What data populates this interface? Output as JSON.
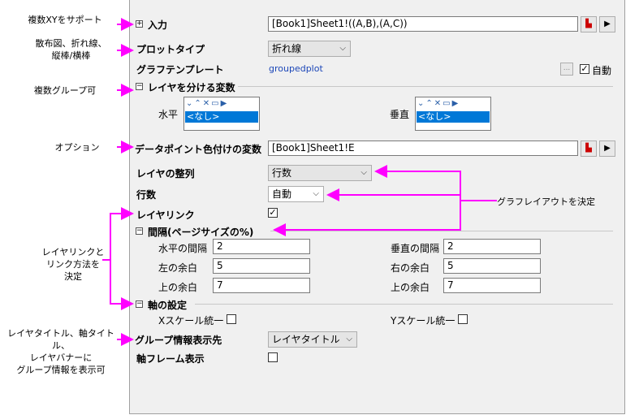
{
  "annotations": {
    "multi_xy": "複数XYをサポート",
    "plot_types": "散布図、折れ線、\n縦棒/横棒",
    "multi_group": "複数グループ可",
    "options": "オプション",
    "graph_layout": "グラフレイアウトを決定",
    "layer_link": "レイヤリンクと\nリンク方法を\n決定",
    "group_info": "レイヤタイトル、軸タイトル、\nレイヤバナーに\nグループ情報を表示可"
  },
  "input": {
    "label": "入力",
    "value": "[Book1]Sheet1!((A,B),(A,C))"
  },
  "plot_type": {
    "label": "プロットタイプ",
    "value": "折れ線"
  },
  "graph_template": {
    "label": "グラフテンプレート",
    "value": "groupedplot",
    "browse": "...",
    "auto_label": "自動",
    "auto_checked": true
  },
  "split_vars": {
    "label": "レイヤを分ける変数",
    "horizontal_label": "水平",
    "vertical_label": "垂直",
    "horizontal_value": "<なし>",
    "vertical_value": "<なし>"
  },
  "color_var": {
    "label": "データポイント色付けの変数",
    "value": "[Book1]Sheet1!E"
  },
  "layer_arrange": {
    "label": "レイヤの整列",
    "value": "行数"
  },
  "rows": {
    "label": "行数",
    "value": "自動"
  },
  "layer_link": {
    "label": "レイヤリンク",
    "checked": true
  },
  "spacing": {
    "label": "間隔(ページサイズの%)",
    "h_gap_label": "水平の間隔",
    "h_gap": "2",
    "v_gap_label": "垂直の間隔",
    "v_gap": "2",
    "left_label": "左の余白",
    "left": "5",
    "right_label": "右の余白",
    "right": "5",
    "top_label": "上の余白",
    "top": "7",
    "bottom_label": "上の余白",
    "bottom": "7"
  },
  "axis": {
    "label": "軸の設定",
    "x_unify": "Xスケール統一",
    "y_unify": "Yスケール統一"
  },
  "group_info_target": {
    "label": "グループ情報表示先",
    "value": "レイヤタイトル"
  },
  "axis_frame": {
    "label": "軸フレーム表示"
  },
  "colors": {
    "annotation_arrow": "#ff00ff",
    "selection": "#0078d7",
    "link_blue": "#1c47b8"
  }
}
